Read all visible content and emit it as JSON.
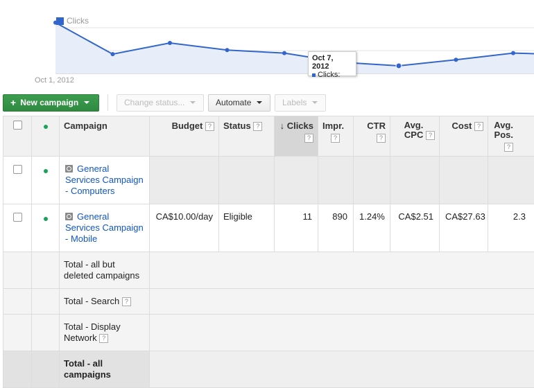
{
  "chart_data": {
    "type": "line",
    "legend": [
      "Clicks"
    ],
    "x_start_label": "Oct 1, 2012",
    "series": [
      {
        "name": "Clicks",
        "values": [
          100,
          38,
          60,
          46,
          40,
          22,
          15,
          27,
          40,
          37
        ]
      }
    ],
    "ylim": [
      0,
      120
    ],
    "tooltip": {
      "date": "Oct 7, 2012",
      "label": "Clicks:"
    },
    "color": "#3366cc"
  },
  "toolbar": {
    "new_campaign": "New campaign",
    "change_status": "Change status...",
    "automate": "Automate",
    "labels": "Labels"
  },
  "table": {
    "headers": {
      "campaign": "Campaign",
      "budget": "Budget",
      "status": "Status",
      "clicks": "Clicks",
      "impr": "Impr.",
      "ctr": "CTR",
      "avg_cpc": "Avg. CPC",
      "cost": "Cost",
      "avg_pos": "Avg. Pos."
    },
    "help_glyph": "?",
    "sort_arrow": "↓",
    "rows": [
      {
        "name": "General Services Campaign - Computers"
      },
      {
        "name": "General Services Campaign - Mobile",
        "budget": "CA$10.00/day",
        "status": "Eligible",
        "clicks": "11",
        "impr": "890",
        "ctr": "1.24%",
        "avg_cpc": "CA$2.51",
        "cost": "CA$27.63",
        "avg_pos": "2.3"
      }
    ],
    "totals": [
      {
        "label": "Total - all but deleted campaigns"
      },
      {
        "label": "Total - Search"
      },
      {
        "label": "Total - Display Network"
      },
      {
        "label": "Total - all campaigns"
      }
    ]
  }
}
